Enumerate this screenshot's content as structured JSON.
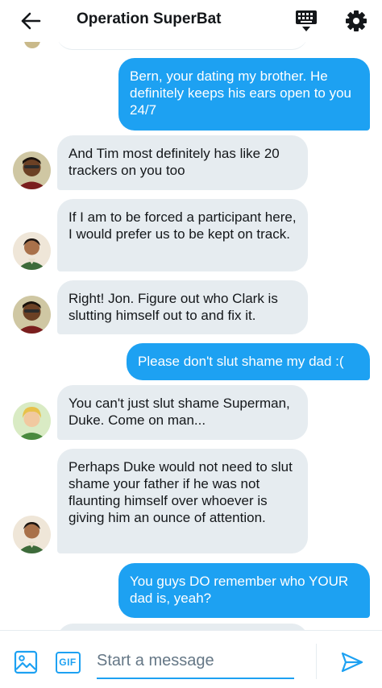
{
  "header": {
    "title": "Operation SuperBat",
    "back_icon": "arrow-left-icon",
    "keyboard_icon": "keyboard-icon",
    "settings_icon": "gear-icon"
  },
  "messages": [
    {
      "from": "me",
      "text": "Bern, your dating my brother. He definitely keeps his ears open to you 24/7"
    },
    {
      "from": "them",
      "sender": "duke",
      "text": "And Tim most definitely has like 20 trackers on you too"
    },
    {
      "from": "them",
      "sender": "damian",
      "text": "If I am to be forced a participant here, I would prefer us to be kept on track."
    },
    {
      "from": "them",
      "sender": "duke",
      "text": "Right! Jon. Figure out who Clark is slutting himself out to and fix it."
    },
    {
      "from": "me",
      "text": "Please don't slut shame my dad :("
    },
    {
      "from": "them",
      "sender": "bernard",
      "text": "You can't just slut shame Superman, Duke. Come on man..."
    },
    {
      "from": "them",
      "sender": "damian",
      "text": "Perhaps Duke would not need to slut shame your father if he was not flaunting himself over whoever is giving him an ounce of attention."
    },
    {
      "from": "me",
      "text": "You guys DO remember who YOUR dad is, yeah?"
    }
  ],
  "composer": {
    "placeholder": "Start a message",
    "image_icon": "image-icon",
    "gif_label": "GIF",
    "send_icon": "send-icon"
  },
  "colors": {
    "accent": "#1da1f2",
    "incoming_bubble": "#e6ecf0",
    "text": "#14171a",
    "placeholder": "#657786"
  }
}
